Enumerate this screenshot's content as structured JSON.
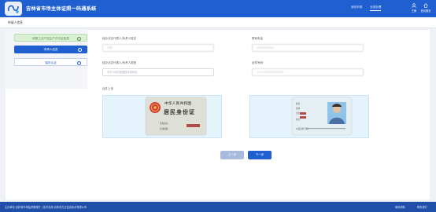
{
  "app": {
    "title": "吉林省市场主体证照一码通系统"
  },
  "header": {
    "nav": [
      "我的申报",
      "业务办理"
    ],
    "icons": [
      {
        "name": "user-icon",
        "label": "王翀"
      },
      {
        "name": "home-icon",
        "label": "首页服务"
      }
    ]
  },
  "breadcrumb": "申请人信息",
  "sidebar": {
    "steps": [
      {
        "label": "填报工业产品生产许可证信息",
        "state": "done"
      },
      {
        "label": "申请人信息",
        "state": "active"
      },
      {
        "label": "保存认证",
        "state": "pending"
      }
    ]
  },
  "form": {
    "name_label": "经办法定代表人/负责人姓名",
    "name_value": "王翀",
    "phone_label": "联系电话",
    "phone_value": "13500000000",
    "idtype_label": "经办法定代表人/负责人类型",
    "idtype_value": "中华人民共和国居民身份证",
    "idno_label": "证件号码",
    "idno_value": "22010000000000000",
    "upload_label": "证件上传"
  },
  "idcard_front": {
    "line1": "中华人民共和国",
    "line2": "居民身份证",
    "authority_label": "签发机关",
    "validity_label": "有效期限"
  },
  "idcard_back": {
    "name_label": "姓名",
    "sex_label": "性别",
    "birth_label": "出生",
    "address_label": "住址",
    "id_label": "公民身份号码"
  },
  "buttons": {
    "prev": "上一步",
    "next": "下一步"
  },
  "footer": {
    "left": "主办单位:吉林省市场监督管理厅 | 技术支持:吉林省方正信息技术有限公司",
    "right1": "使用帮助",
    "right2": "联系我们"
  },
  "colors": {
    "primary": "#1f5fd0",
    "done": "#d9f0d4",
    "footer": "#1f4fa8"
  }
}
